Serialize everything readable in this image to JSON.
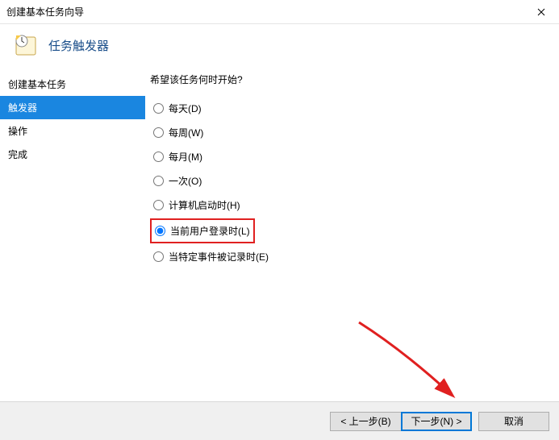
{
  "window": {
    "title": "创建基本任务向导"
  },
  "header": {
    "title": "任务触发器"
  },
  "sidebar": {
    "items": [
      {
        "label": "创建基本任务",
        "active": false
      },
      {
        "label": "触发器",
        "active": true
      },
      {
        "label": "操作",
        "active": false
      },
      {
        "label": "完成",
        "active": false
      }
    ]
  },
  "main": {
    "prompt": "希望该任务何时开始?",
    "options": [
      {
        "label": "每天(D)",
        "value": "daily",
        "checked": false
      },
      {
        "label": "每周(W)",
        "value": "weekly",
        "checked": false
      },
      {
        "label": "每月(M)",
        "value": "monthly",
        "checked": false
      },
      {
        "label": "一次(O)",
        "value": "once",
        "checked": false
      },
      {
        "label": "计算机启动时(H)",
        "value": "startup",
        "checked": false
      },
      {
        "label": "当前用户登录时(L)",
        "value": "logon",
        "checked": true,
        "highlighted": true
      },
      {
        "label": "当特定事件被记录时(E)",
        "value": "event",
        "checked": false
      }
    ]
  },
  "footer": {
    "back": "< 上一步(B)",
    "next": "下一步(N) >",
    "cancel": "取消"
  }
}
